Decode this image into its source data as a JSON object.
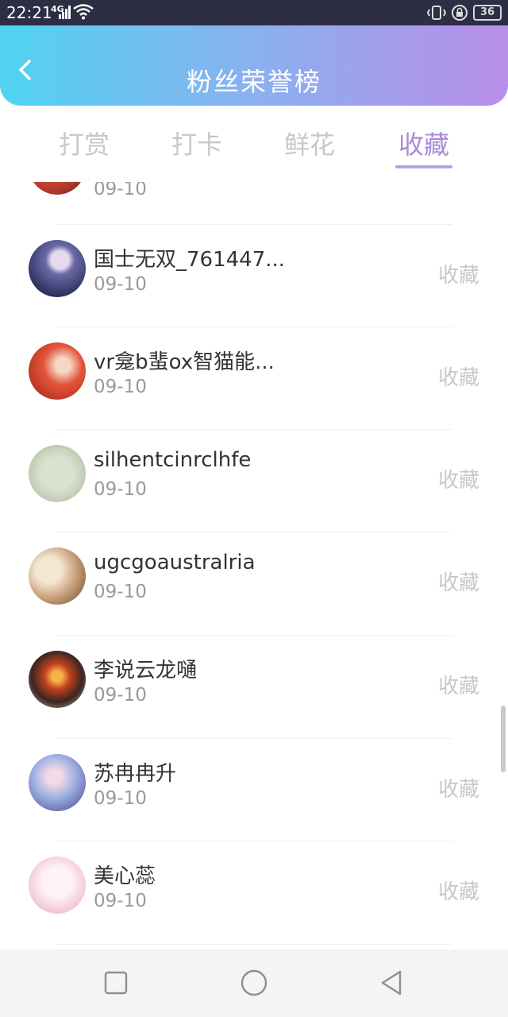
{
  "status": {
    "time": "22:21",
    "network": "4G",
    "battery": "36"
  },
  "header": {
    "title": "粉丝荣誉榜"
  },
  "tabs": [
    {
      "label": "打赏",
      "active": false
    },
    {
      "label": "打卡",
      "active": false
    },
    {
      "label": "鲜花",
      "active": false
    },
    {
      "label": "收藏",
      "active": true
    }
  ],
  "list": {
    "partial_top": {
      "date": "09-10"
    },
    "items": [
      {
        "name": "国士无双_761447...",
        "date": "09-10",
        "action": "收藏"
      },
      {
        "name": "vr龛b蜚ox智猫能...",
        "date": "09-10",
        "action": "收藏"
      },
      {
        "name": "silhentcinrclhfe",
        "date": "09-10",
        "action": "收藏"
      },
      {
        "name": "ugcgoaustralria",
        "date": "09-10",
        "action": "收藏"
      },
      {
        "name": "李说云龙嗵",
        "date": "09-10",
        "action": "收藏"
      },
      {
        "name": "苏冉冉升",
        "date": "09-10",
        "action": "收藏"
      },
      {
        "name": "美心蕊",
        "date": "09-10",
        "action": "收藏"
      }
    ]
  },
  "colors": {
    "accent": "#a98ad8",
    "gradient_start": "#4fd3f0",
    "gradient_end": "#b98ee8"
  },
  "icons": {
    "back": "chevron-left-icon",
    "nav_recent": "square-icon",
    "nav_home": "circle-icon",
    "nav_back": "triangle-back-icon"
  }
}
